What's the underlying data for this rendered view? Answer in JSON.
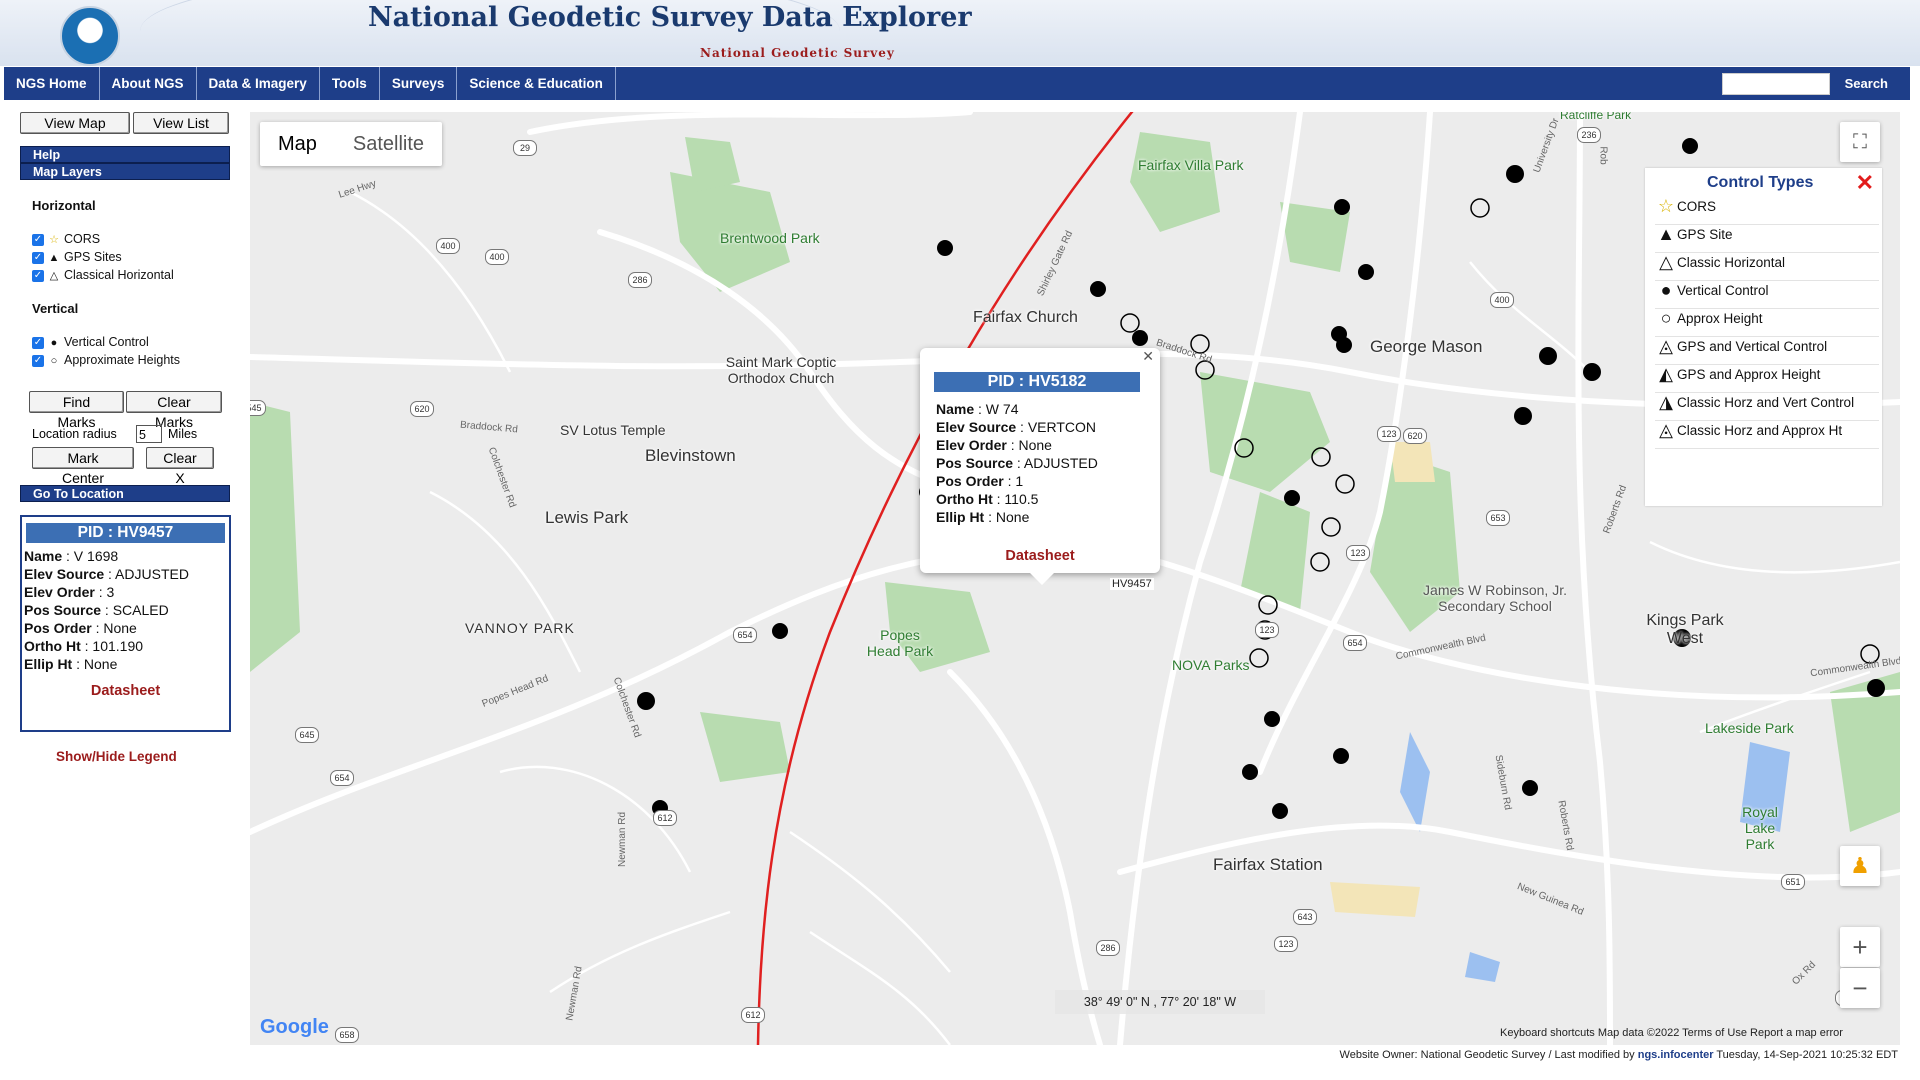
{
  "header": {
    "title": "National Geodetic Survey Data Explorer",
    "subtitle": "National Geodetic Survey",
    "logo_text": "NOAA"
  },
  "nav": {
    "items": [
      "NGS Home",
      "About NGS",
      "Data & Imagery",
      "Tools",
      "Surveys",
      "Science & Education"
    ],
    "search_label": "Search"
  },
  "sidebar": {
    "view_map": "View Map",
    "view_list": "View List",
    "help": "Help",
    "map_layers": "Map Layers",
    "horizontal_title": "Horizontal",
    "horizontal_items": [
      "CORS",
      "GPS Sites",
      "Classical Horizontal"
    ],
    "vertical_title": "Vertical",
    "vertical_items": [
      "Vertical Control",
      "Approximate Heights"
    ],
    "find_marks": "Find Marks",
    "clear_marks": "Clear Marks",
    "location_radius_label": "Location radius",
    "location_radius_value": "5",
    "location_radius_unit": "Miles",
    "mark_center": "Mark Center",
    "clear_x": "Clear X",
    "go_to_location": "Go To Location",
    "show_hide_legend": "Show/Hide Legend"
  },
  "sidebar_card": {
    "pid": "PID : HV9457",
    "name_label": "Name",
    "name": " : V 1698",
    "elev_source_label": "Elev Source",
    "elev_source": " : ADJUSTED",
    "elev_order_label": "Elev Order",
    "elev_order": " : 3",
    "pos_source_label": "Pos Source",
    "pos_source": " : SCALED",
    "pos_order_label": "Pos Order",
    "pos_order": " : None",
    "ortho_ht_label": "Ortho Ht",
    "ortho_ht": " : 101.190",
    "ellip_ht_label": "Ellip Ht",
    "ellip_ht": " : None",
    "datasheet": "Datasheet"
  },
  "map": {
    "type_map": "Map",
    "type_satellite": "Satellite",
    "coords": "38° 49' 0\" N , 77° 20' 18\" W",
    "attribution": "Keyboard shortcuts     Map data ©2022     Terms of Use     Report a map error",
    "google": "Google",
    "hover_label": "HV9457",
    "places": [
      "Fairfax Villa Park",
      "Brentwood Park",
      "Fairfax Church",
      "George Mason",
      "Saint Mark Coptic Orthodox Church",
      "SV Lotus Temple",
      "Blevinstown",
      "Lewis Park",
      "VANNOY PARK",
      "Popes Head Park",
      "NOVA Parks",
      "James W Robinson, Jr. Secondary School",
      "Kings Park West",
      "Lakeside Park",
      "Royal Lake Park",
      "Fairfax Station",
      "Ratcliffe Park"
    ],
    "roads": [
      "Lee Hwy",
      "Braddock Rd",
      "Braddock Rd",
      "Colchester Rd",
      "Popes Head Rd",
      "Colchester Rd",
      "Newman Rd",
      "Newman Rd",
      "Commonwealth Blvd",
      "Commonwealth Blvd",
      "Roberts Rd",
      "Roberts Rd",
      "Sideburn Rd",
      "New Guinea Rd",
      "Ox Rd",
      "Shirley Gate Rd",
      "University Dr",
      "Rob"
    ],
    "shields": [
      "29",
      "286",
      "400",
      "236",
      "620",
      "123",
      "620",
      "654",
      "123",
      "653",
      "654",
      "645",
      "654",
      "612",
      "643",
      "123",
      "286",
      "123",
      "612",
      "658",
      "651",
      "645",
      "545",
      "400",
      "400"
    ]
  },
  "control_types": {
    "title": "Control Types",
    "items": [
      "CORS",
      "GPS Site",
      "Classic Horizontal",
      "Vertical Control",
      "Approx Height",
      "GPS and Vertical Control",
      "GPS and Approx Height",
      "Classic Horz and Vert Control",
      "Classic Horz and Approx Ht"
    ]
  },
  "popup": {
    "pid": "PID : HV5182",
    "name_label": "Name",
    "name": " : W 74",
    "elev_source_label": "Elev Source",
    "elev_source": " : VERTCON",
    "elev_order_label": "Elev Order",
    "elev_order": " : None",
    "pos_source_label": "Pos Source",
    "pos_source": " : ADJUSTED",
    "pos_order_label": "Pos Order",
    "pos_order": " : 1",
    "ortho_ht_label": "Ortho Ht",
    "ortho_ht": " : 110.5",
    "ellip_ht_label": "Ellip Ht",
    "ellip_ht": " : None",
    "datasheet": "Datasheet"
  },
  "footer": {
    "owner": "Website Owner: National Geodetic Survey  /  Last modified by ",
    "owner_link": "ngs.infocenter",
    "date": " Tuesday, 14-Sep-2021 10:25:32 EDT"
  }
}
